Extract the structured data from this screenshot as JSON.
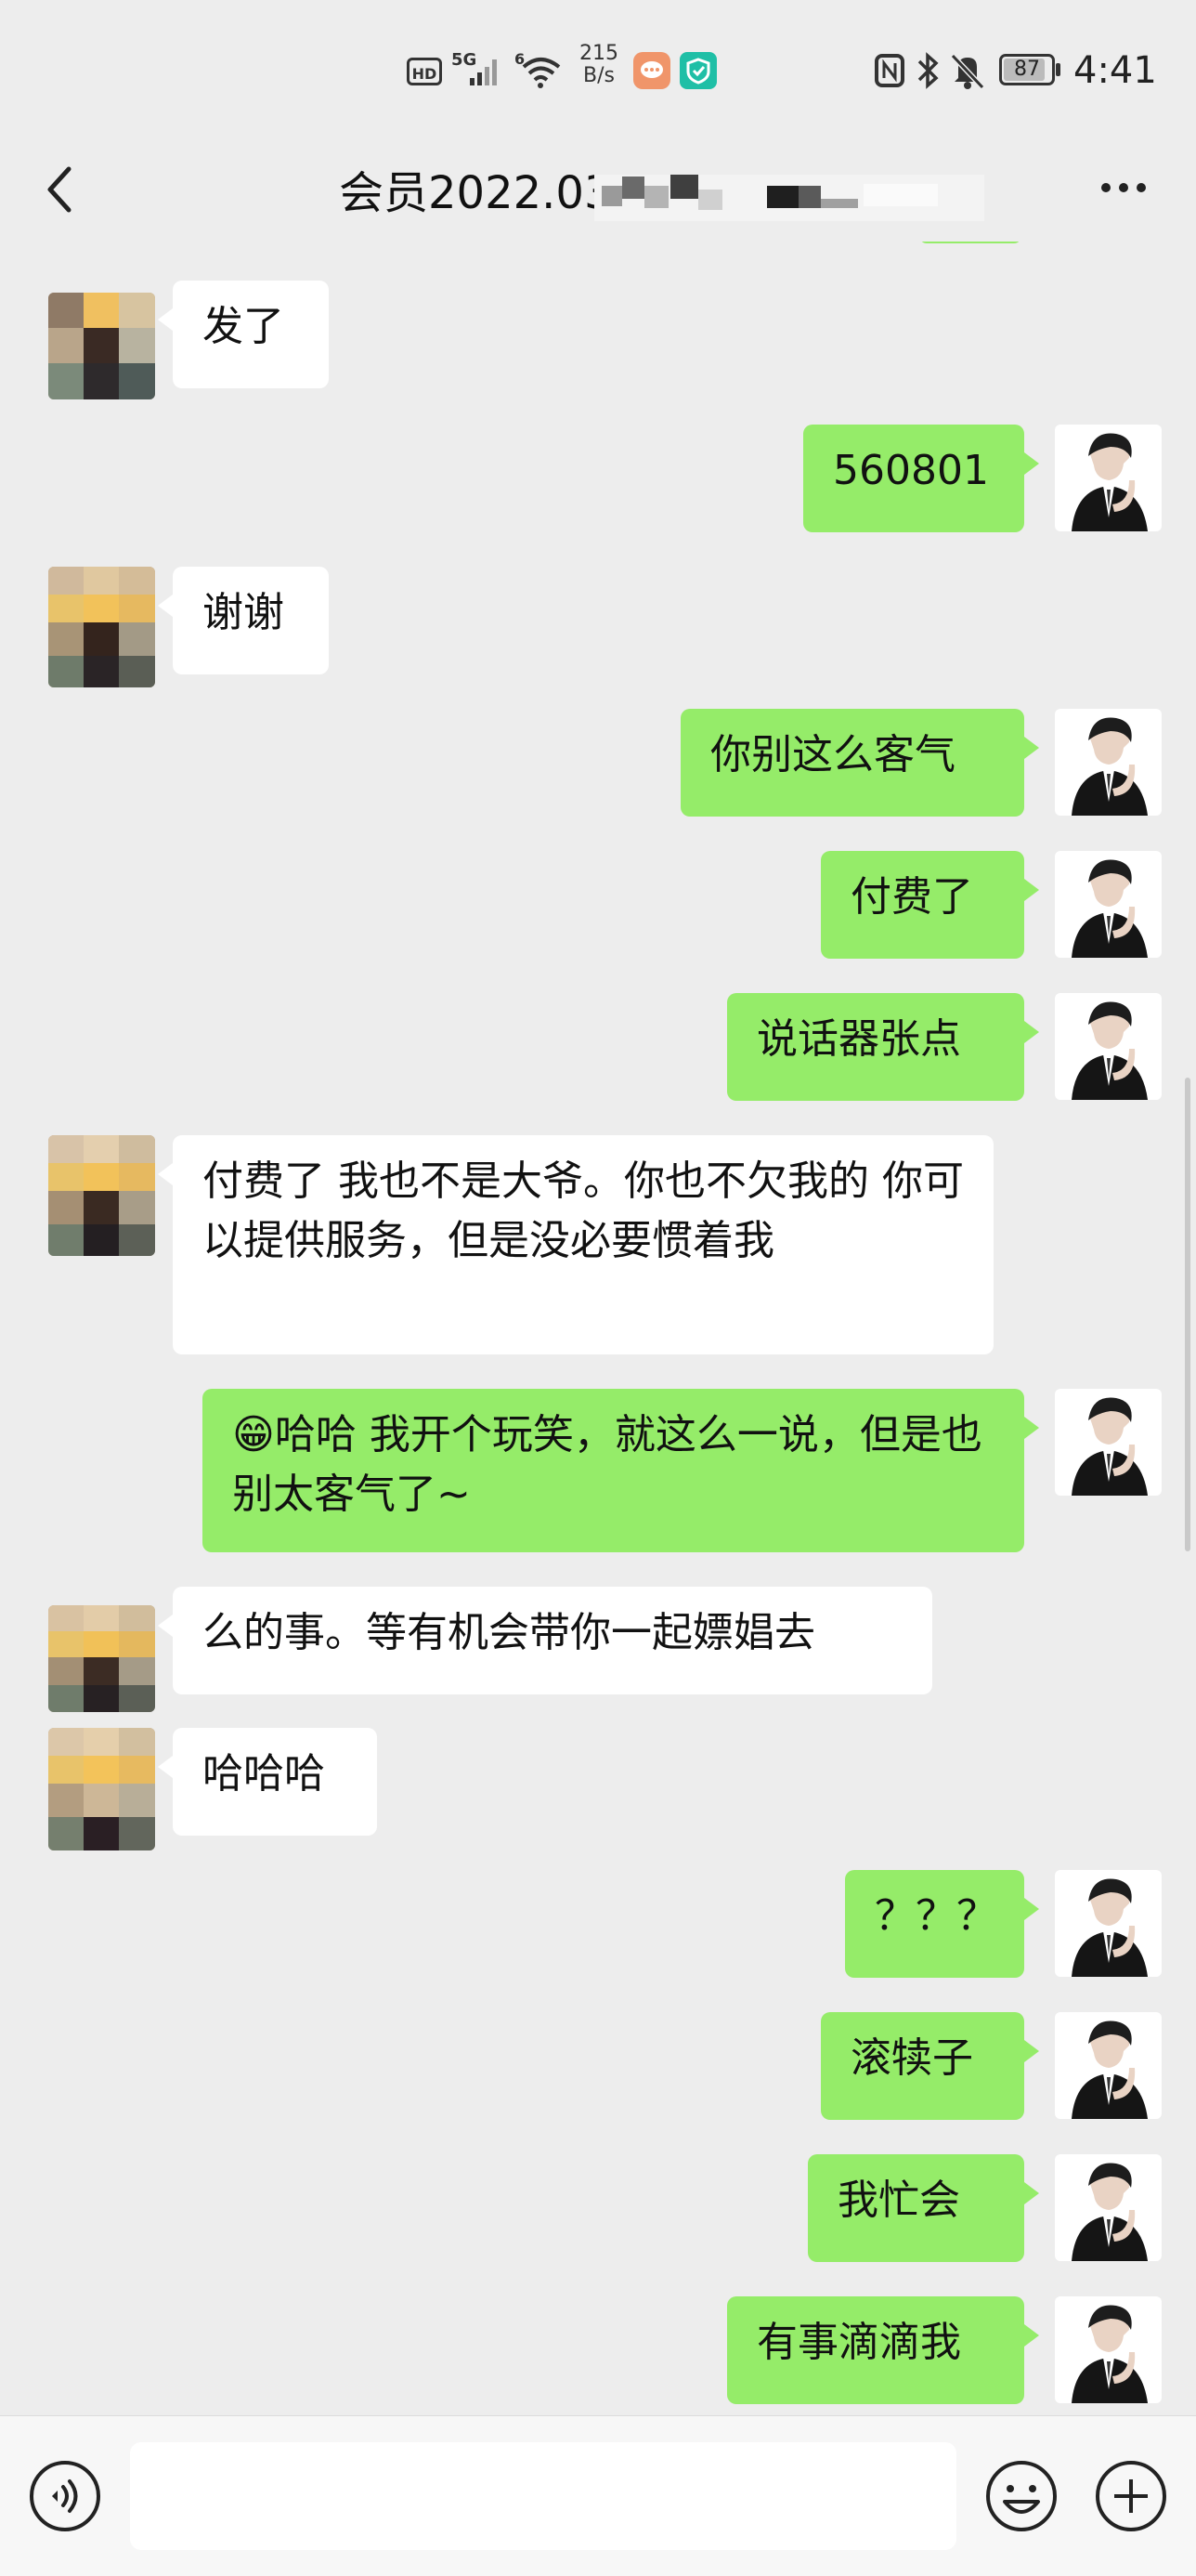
{
  "status_bar": {
    "hd": "HD",
    "net1": "5G",
    "net2": "6",
    "speed_value": "215",
    "speed_unit": "B/s",
    "battery": "87",
    "time": "4:41"
  },
  "header": {
    "title": "会员2022.03"
  },
  "messages": [
    {
      "side": "in",
      "text": "发了"
    },
    {
      "side": "out",
      "text": "560801"
    },
    {
      "side": "in",
      "text": "谢谢"
    },
    {
      "side": "out",
      "text": "你别这么客气"
    },
    {
      "side": "out",
      "text": "付费了"
    },
    {
      "side": "out",
      "text": "说话器张点"
    },
    {
      "side": "in",
      "text": "付费了 我也不是大爷。你也不欠我的 你可以提供服务，但是没必要惯着我"
    },
    {
      "side": "out",
      "text": "😁哈哈 我开个玩笑，就这么一说，但是也别太客气了~"
    },
    {
      "side": "in",
      "text": "么的事。等有机会带你一起嫖娼去"
    },
    {
      "side": "in",
      "text": "哈哈哈"
    },
    {
      "side": "out",
      "text": "？？？"
    },
    {
      "side": "out",
      "text": "滚犊子"
    },
    {
      "side": "out",
      "text": "我忙会"
    },
    {
      "side": "out",
      "text": "有事滴滴我"
    }
  ],
  "icons": {
    "back": "chevron-left-icon",
    "more": "more-dots-icon",
    "voice": "voice-icon",
    "emoji": "emoji-icon",
    "plus": "plus-icon"
  },
  "colors": {
    "background": "#ededed",
    "incoming_bubble": "#ffffff",
    "outgoing_bubble": "#95ec69"
  }
}
